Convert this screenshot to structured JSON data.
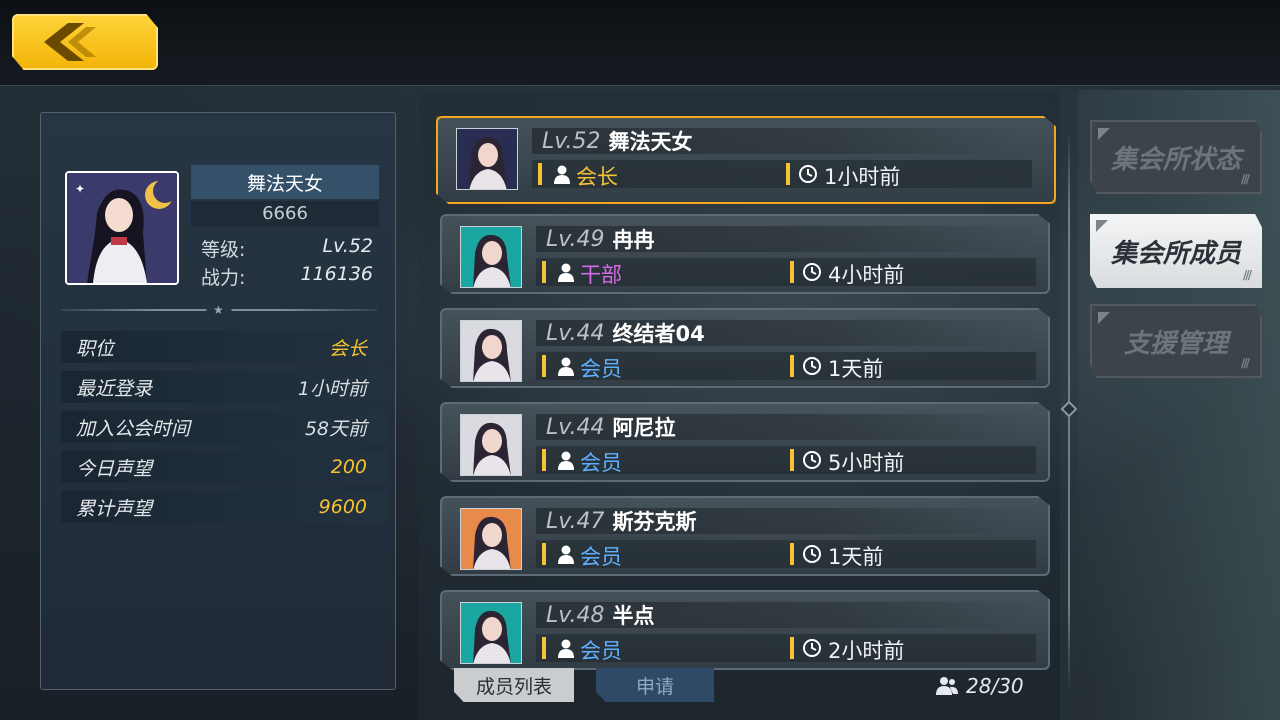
{
  "profile": {
    "name": "舞法天女",
    "uid": "6666",
    "level_label": "等级:",
    "level_value": "Lv.52",
    "power_label": "战力:",
    "power_value": "116136",
    "info": [
      {
        "label": "职位",
        "value": "会长",
        "highlight": true
      },
      {
        "label": "最近登录",
        "value": "1小时前",
        "highlight": false
      },
      {
        "label": "加入公会时间",
        "value": "58天前",
        "highlight": false
      },
      {
        "label": "今日声望",
        "value": "200",
        "highlight": true
      },
      {
        "label": "累计声望",
        "value": "9600",
        "highlight": true
      }
    ]
  },
  "members": [
    {
      "level": "Lv.52",
      "name": "舞法天女",
      "role": "会长",
      "role_type": "leader",
      "last_seen": "1小时前",
      "selected": true,
      "avatar_bg": "#2a2d52"
    },
    {
      "level": "Lv.49",
      "name": "冉冉",
      "role": "干部",
      "role_type": "officer",
      "last_seen": "4小时前",
      "selected": false,
      "avatar_bg": "#1aa7a1"
    },
    {
      "level": "Lv.44",
      "name": "终结者04",
      "role": "会员",
      "role_type": "member",
      "last_seen": "1天前",
      "selected": false,
      "avatar_bg": "#d9dbe0"
    },
    {
      "level": "Lv.44",
      "name": "阿尼拉",
      "role": "会员",
      "role_type": "member",
      "last_seen": "5小时前",
      "selected": false,
      "avatar_bg": "#d9dbe0"
    },
    {
      "level": "Lv.47",
      "name": "斯芬克斯",
      "role": "会员",
      "role_type": "member",
      "last_seen": "1天前",
      "selected": false,
      "avatar_bg": "#e88a4a"
    },
    {
      "level": "Lv.48",
      "name": "半点",
      "role": "会员",
      "role_type": "member",
      "last_seen": "2小时前",
      "selected": false,
      "avatar_bg": "#1aa7a1"
    }
  ],
  "bottom": {
    "tab_members": "成员列表",
    "tab_apply": "申请",
    "member_count": "28/30"
  },
  "side_tabs": [
    {
      "label": "集会所状态",
      "active": false
    },
    {
      "label": "集会所成员",
      "active": true
    },
    {
      "label": "支援管理",
      "active": false
    }
  ],
  "colors": {
    "leader": "#f6c233",
    "officer": "#d56ae8",
    "member": "#5fb0ff",
    "accent": "#f4a71e"
  },
  "icons": {
    "back": "chevron-left-icon",
    "person": "person-icon",
    "clock": "clock-icon",
    "people": "people-icon"
  }
}
